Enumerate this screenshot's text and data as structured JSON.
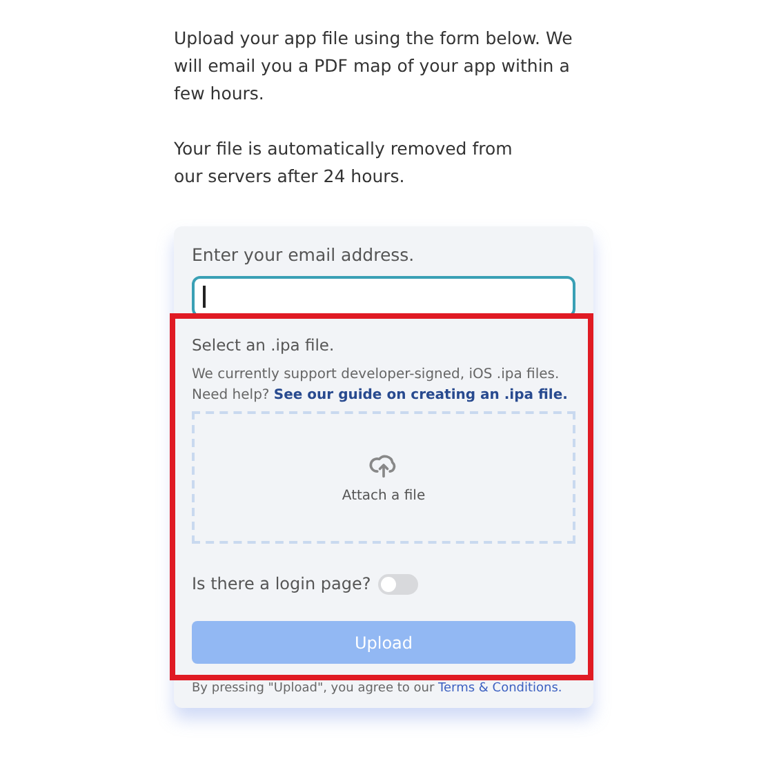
{
  "intro": [
    "Upload your app file using the form below. We will email you a PDF map of your app within a few hours.",
    "Your file is automatically removed from our servers after 24 hours."
  ],
  "email": {
    "label": "Enter your email address.",
    "focused": true
  },
  "file": {
    "label": "Select an .ipa file.",
    "note": "We currently support developer-signed, iOS .ipa files. Need help? ",
    "link": "See our guide on creating an .ipa file.",
    "dropzone": "Attach a file"
  },
  "login_toggle": {
    "label": "Is there a login page?",
    "on": false
  },
  "upload_button": {
    "label": "Upload",
    "disabled": true
  },
  "terms": {
    "text": "By pressing \"Upload\", you agree to our ",
    "link": "Terms & Conditions."
  },
  "highlight": {
    "kind": "frame"
  }
}
